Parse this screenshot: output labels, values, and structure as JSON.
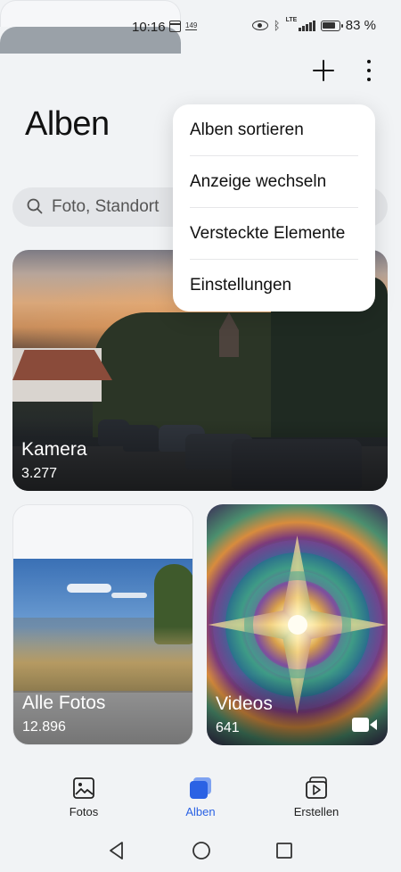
{
  "status_bar": {
    "time": "10:16",
    "badge": "149",
    "network": "LTE",
    "battery": "83 %",
    "icons": [
      "calendar-icon",
      "eye-icon",
      "bluetooth-icon",
      "signal-icon",
      "battery-icon"
    ]
  },
  "header": {
    "title": "Alben",
    "actions": [
      "add-icon",
      "more-vertical-icon"
    ]
  },
  "search": {
    "placeholder": "Foto, Standort"
  },
  "menu": {
    "items": [
      "Alben sortieren",
      "Anzeige wechseln",
      "Versteckte Elemente",
      "Einstellungen"
    ]
  },
  "albums": [
    {
      "name": "Kamera",
      "count": "3.277"
    },
    {
      "name": "Alle Fotos",
      "count": "12.896"
    },
    {
      "name": "Videos",
      "count": "641"
    }
  ],
  "bottom_nav": {
    "items": [
      {
        "label": "Fotos",
        "icon": "image-icon",
        "active": false
      },
      {
        "label": "Alben",
        "icon": "albums-icon",
        "active": true
      },
      {
        "label": "Erstellen",
        "icon": "create-icon",
        "active": false
      }
    ]
  },
  "colors": {
    "accent": "#2b62e4",
    "background": "#f1f3f5"
  }
}
